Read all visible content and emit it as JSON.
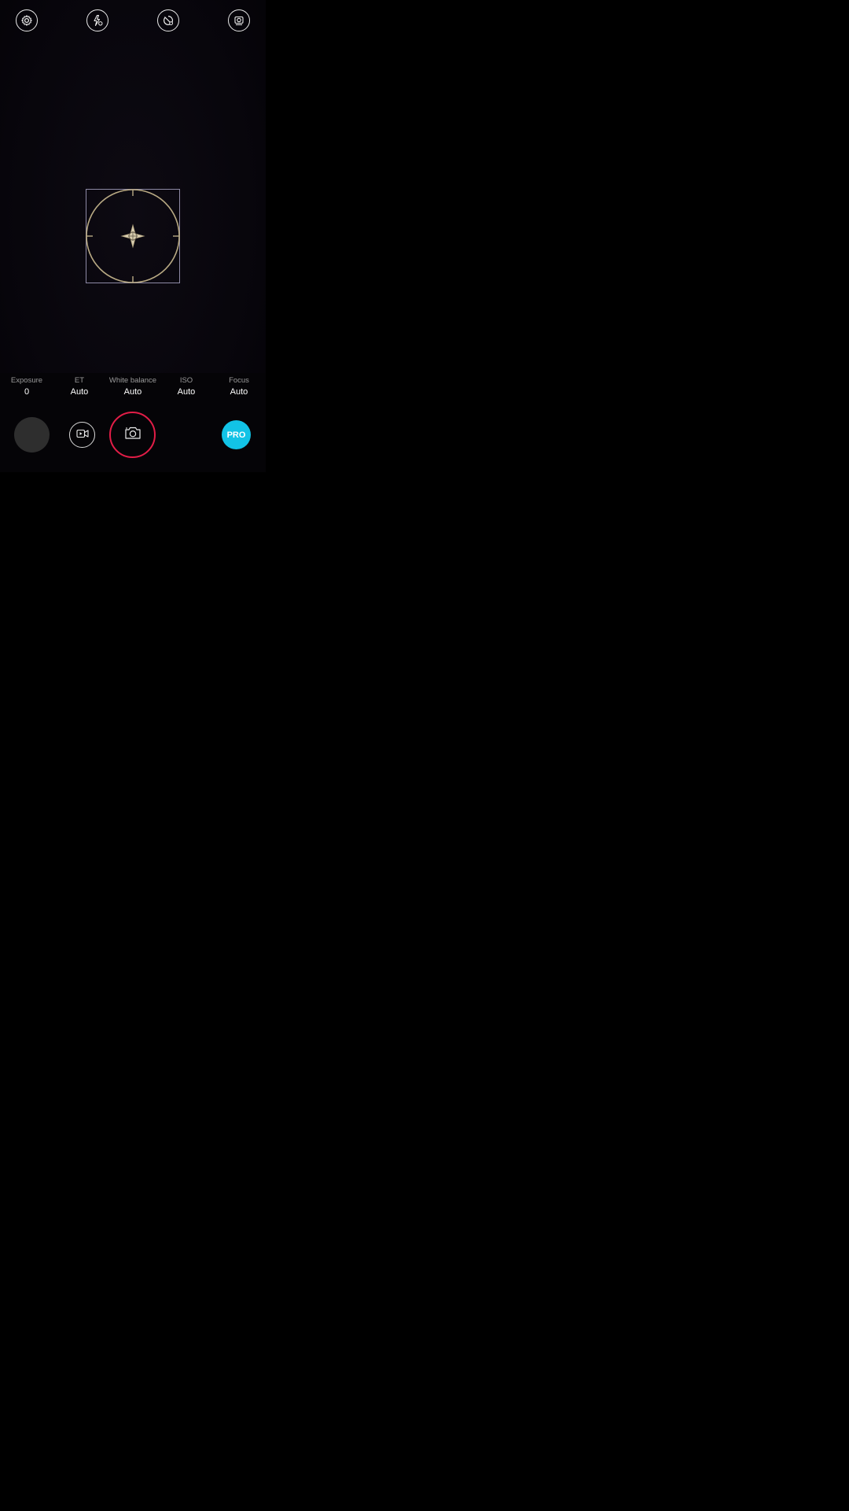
{
  "top_bar": {
    "icons": [
      {
        "name": "settings-icon"
      },
      {
        "name": "flash-auto-icon"
      },
      {
        "name": "timer-icon"
      },
      {
        "name": "camera-mode-icon"
      }
    ]
  },
  "viewfinder": {
    "focus_reticle": "focus-reticle"
  },
  "pro_controls": {
    "params": [
      {
        "label": "Exposure",
        "value": "0"
      },
      {
        "label": "ET",
        "value": "Auto"
      },
      {
        "label": "White balance",
        "value": "Auto"
      },
      {
        "label": "ISO",
        "value": "Auto"
      },
      {
        "label": "Focus",
        "value": "Auto"
      }
    ]
  },
  "bottom_bar": {
    "gallery": "gallery-thumbnail",
    "video_icon": "video-camera-icon",
    "shutter_icon": "camera-icon",
    "mode_label": "PRO"
  },
  "colors": {
    "shutter_ring": "#e21d47",
    "pro_accent": "#12c3e6",
    "focus_ring": "#b9aa84",
    "focus_box": "#8e8aa6"
  }
}
